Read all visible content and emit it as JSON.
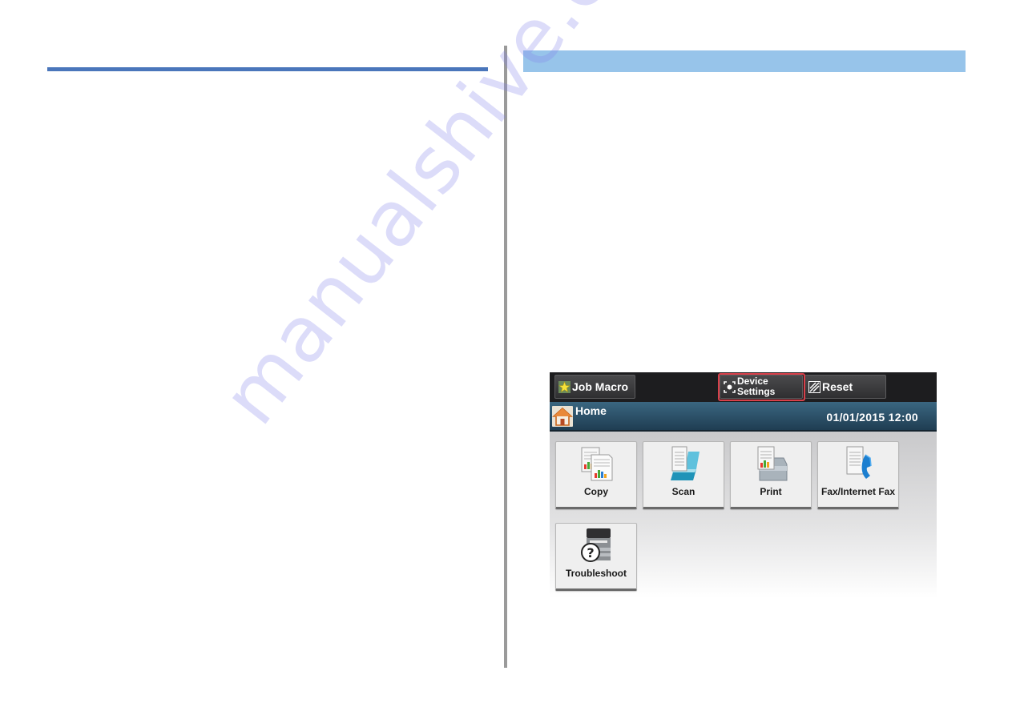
{
  "page": {
    "watermark": "manualshive.com",
    "colors": {
      "heading_rule": "#4a76bb",
      "section_band": "#97c4ea",
      "divider": "#9a9a9a",
      "highlight": "#d8404a"
    }
  },
  "device_panel": {
    "top_buttons": [
      {
        "label": "Job Macro",
        "icon": "star-icon"
      },
      {
        "label_line1": "Device",
        "label_line2": "Settings",
        "icon": "settings-icon",
        "highlighted": true
      },
      {
        "label": "Reset",
        "icon": "reset-icon"
      }
    ],
    "header": {
      "title": "Home",
      "icon": "home-icon",
      "datetime": "01/01/2015 12:00"
    },
    "tiles": [
      {
        "label": "Copy",
        "icon": "copy-icon"
      },
      {
        "label": "Scan",
        "icon": "scan-icon"
      },
      {
        "label": "Print",
        "icon": "print-icon"
      },
      {
        "label": "Fax/Internet Fax",
        "icon": "fax-icon"
      },
      {
        "label": "Troubleshoot",
        "icon": "troubleshoot-icon"
      }
    ]
  }
}
